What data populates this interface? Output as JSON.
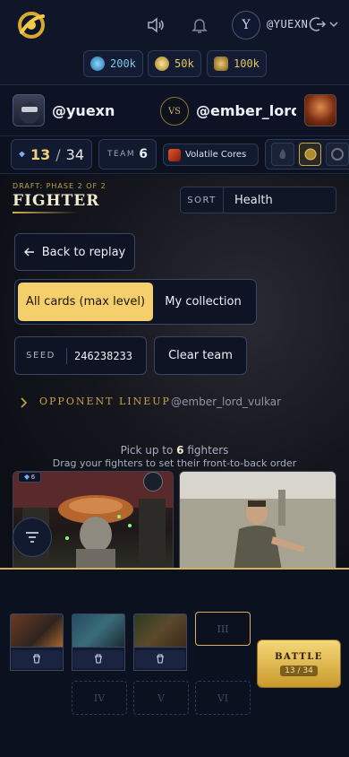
{
  "header": {
    "avatar_initial": "Y",
    "username": "@YUEXN",
    "currencies": [
      {
        "name": "blue-gem",
        "value": "200k",
        "color": "#4fb6e8"
      },
      {
        "name": "gold-gem",
        "value": "50k",
        "color": "#d9b24b"
      },
      {
        "name": "k-coin",
        "value": "100k",
        "color": "#c9a445"
      }
    ]
  },
  "match": {
    "player": "@yuexn",
    "vs": "VS",
    "opponent": "@ember_lord..."
  },
  "stats": {
    "count": "13",
    "separator": "/",
    "total": "34",
    "team_label": "TEAM",
    "team_value": "6",
    "cores_label": "Volatile Cores"
  },
  "draft": {
    "phase": "DRAFT: PHASE 2 OF 2",
    "title": "FIGHTER",
    "sort_label": "SORT",
    "sort_value": "Health",
    "back_label": "Back to replay",
    "toggle_all": "All cards (max level)",
    "toggle_mine": "My collection",
    "seed_label": "SEED",
    "seed_value": "246238233",
    "clear_label": "Clear team",
    "opp_label": "OPPONENT LINEUP",
    "opp_name": "@ember_lord_vulkar",
    "hint_pre": "Pick up to ",
    "hint_num": "6",
    "hint_post": " fighters",
    "hint2": "Drag your fighters to set their front-to-back order",
    "card1_badge": "6"
  },
  "team": {
    "empty_slots": [
      "III",
      "IV",
      "V",
      "VI"
    ],
    "battle_label": "BATTLE",
    "battle_count": "13 / 34"
  }
}
